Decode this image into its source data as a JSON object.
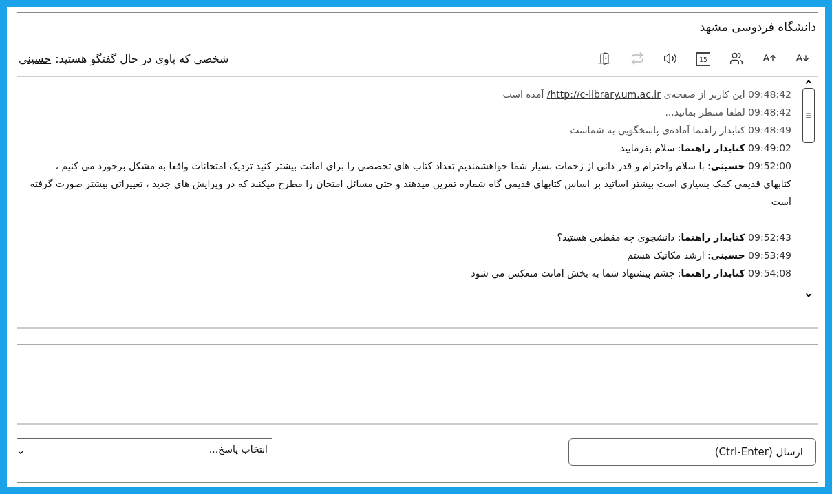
{
  "window": {
    "title": "دانشگاه فردوسی مشهد"
  },
  "toolbar": {
    "partner_label": "شخصی که باوی در حال گفتگو هستید:",
    "partner_name": "حسینی",
    "icons": [
      {
        "kind": "exit",
        "disabled": false
      },
      {
        "kind": "transfer",
        "disabled": true
      },
      {
        "kind": "sound",
        "disabled": false
      },
      {
        "kind": "calendar",
        "disabled": false,
        "day": "15"
      },
      {
        "kind": "users",
        "disabled": false
      },
      {
        "kind": "font-larger",
        "disabled": false
      },
      {
        "kind": "font-smaller",
        "disabled": false
      }
    ]
  },
  "messages": [
    {
      "kind": "system",
      "time": "09:48:42",
      "paragraphs": [
        "این کاربر از صفحه‌ی"
      ],
      "link": "http://c-library.um.ac.ir/",
      "after_link": "آمده است"
    },
    {
      "kind": "system",
      "time": "09:48:42",
      "paragraphs": [
        "لطفا منتظر بمانید..."
      ]
    },
    {
      "kind": "system",
      "time": "09:48:49",
      "paragraphs": [
        "کتابدار راهنما آماده‌ی پاسخگویی به شماست"
      ]
    },
    {
      "kind": "chat",
      "time": "09:49:02",
      "sender": "کتابدار راهنما",
      "paragraphs": [
        ": سلام بفرمایید"
      ]
    },
    {
      "kind": "chat",
      "time": "09:52:00",
      "sender": "حسینی",
      "paragraphs": [
        ": با سلام واحترام و قدر دانی از زحمات بسیار شما خواهشمندیم تعداد کتاب های تخصصی را برای امانت بیشتر کنید تزدیک امتحانات واقعا به مشکل برخورد می کنیم ،",
        "کتابهای قدیمی کمک بسیاری است بیشتر اساتید بر اساس کتابهای قدیمی گاه شماره تمرین میدهند و حتی مسائل امتحان را مطرح میکنند که در ویرایش های جدید ، تغییراتی بیشتر صورت گرفته است"
      ],
      "gap_after": true
    },
    {
      "kind": "chat",
      "time": "09:52:43",
      "sender": "کتابدار راهنما",
      "paragraphs": [
        ": دانشجوی چه مقطعی هستید؟"
      ]
    },
    {
      "kind": "chat",
      "time": "09:53:49",
      "sender": "حسینی",
      "paragraphs": [
        ": ارشد مکانیک هستم"
      ]
    },
    {
      "kind": "chat",
      "time": "09:54:08",
      "sender": "کتابدار راهنما",
      "paragraphs": [
        ": چشم پیشنهاد شما به بخش امانت منعکس می شود"
      ]
    }
  ],
  "reply_select": {
    "placeholder": "انتخاب پاسخ..."
  },
  "send_button": {
    "label": "ارسال (Ctrl-Enter)"
  }
}
